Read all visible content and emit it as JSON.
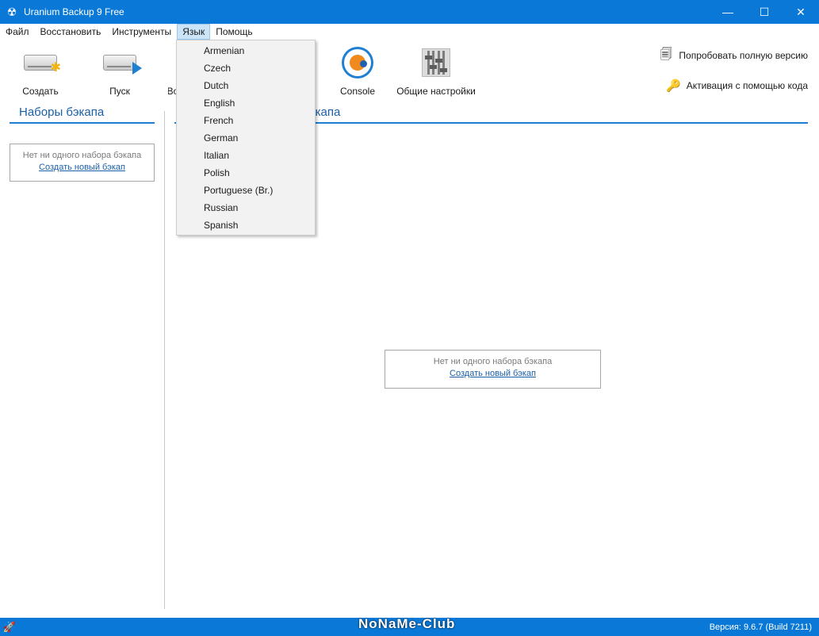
{
  "window": {
    "title": "Uranium Backup 9 Free",
    "icon": "radiation-icon",
    "controls": {
      "minimize": "—",
      "maximize": "☐",
      "close": "✕"
    }
  },
  "menubar": {
    "items": [
      "Файл",
      "Восстановить",
      "Инструменты",
      "Язык",
      "Помощь"
    ],
    "active": "Язык"
  },
  "toolbar": {
    "create": "Создать",
    "run": "Пуск",
    "partial_label": "Во",
    "console": "Console",
    "settings": "Общие настройки",
    "try_full": "Попробовать полную версию",
    "activate": "Активация с помощью кода"
  },
  "left_panel": {
    "title": "Наборы бэкапа",
    "empty_message": "Нет ни одного набора бэкапа",
    "create_link": "Создать новый бэкап"
  },
  "right_panel": {
    "title_partial": "экапа",
    "empty_message": "Нет ни одного набора бэкапа",
    "create_link": "Создать новый бэкап"
  },
  "language_menu": {
    "options": [
      "Armenian",
      "Czech",
      "Dutch",
      "English",
      "French",
      "German",
      "Italian",
      "Polish",
      "Portuguese (Br.)",
      "Russian",
      "Spanish"
    ]
  },
  "statusbar": {
    "version": "Версия: 9.6.7 (Build 7211)",
    "watermark": "NoNaMe-Club",
    "icon": "rocket-icon"
  },
  "colors": {
    "accent": "#0a78d7",
    "link": "#1a5fa8",
    "menu_highlight": "#cce4f7"
  }
}
